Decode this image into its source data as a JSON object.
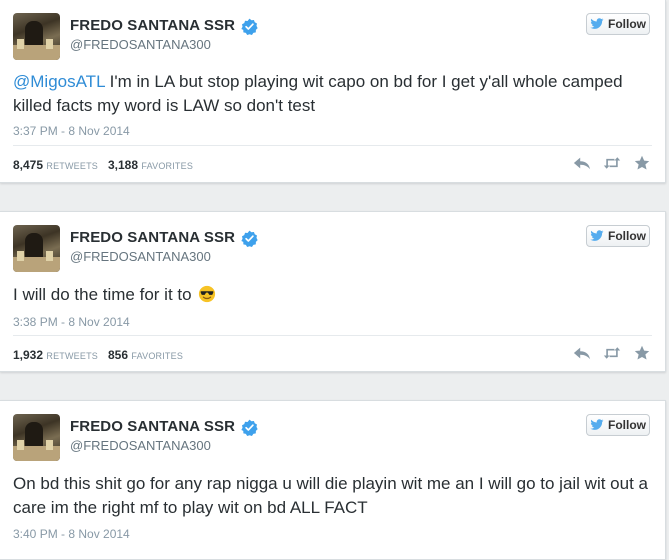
{
  "tweets": [
    {
      "author": {
        "name": "FREDO SANTANA SSR",
        "handle": "@FREDOSANTANA300",
        "verified": true
      },
      "follow_label": "Follow",
      "mention": "@MigosATL",
      "text": " I'm in LA but stop playing wit capo on bd for I get y'all whole camped killed facts my word is LAW so don't test",
      "timestamp": "3:37 PM - 8 Nov 2014",
      "retweets": "8,475",
      "retweets_label": "RETWEETS",
      "favorites": "3,188",
      "favorites_label": "FAVORITES"
    },
    {
      "author": {
        "name": "FREDO SANTANA SSR",
        "handle": "@FREDOSANTANA300",
        "verified": true
      },
      "follow_label": "Follow",
      "text": "I will do the time for it to",
      "emoji": "sunglasses-face-emoji",
      "timestamp": "3:38 PM - 8 Nov 2014",
      "retweets": "1,932",
      "retweets_label": "RETWEETS",
      "favorites": "856",
      "favorites_label": "FAVORITES"
    },
    {
      "author": {
        "name": "FREDO SANTANA SSR",
        "handle": "@FREDOSANTANA300",
        "verified": true
      },
      "follow_label": "Follow",
      "text": "On bd this shit go for any rap nigga u will die playin wit me an I will go to jail wit out a care im the right mf to play wit on bd ALL FACT",
      "timestamp": "3:40 PM - 8 Nov 2014"
    }
  ],
  "colors": {
    "link": "#2f8cd6",
    "verified": "#3ea1ec",
    "text": "#292f33",
    "muted": "#8899a6"
  },
  "icons": [
    "verified-badge-icon",
    "twitter-bird-icon",
    "reply-icon",
    "retweet-icon",
    "favorite-star-icon"
  ]
}
